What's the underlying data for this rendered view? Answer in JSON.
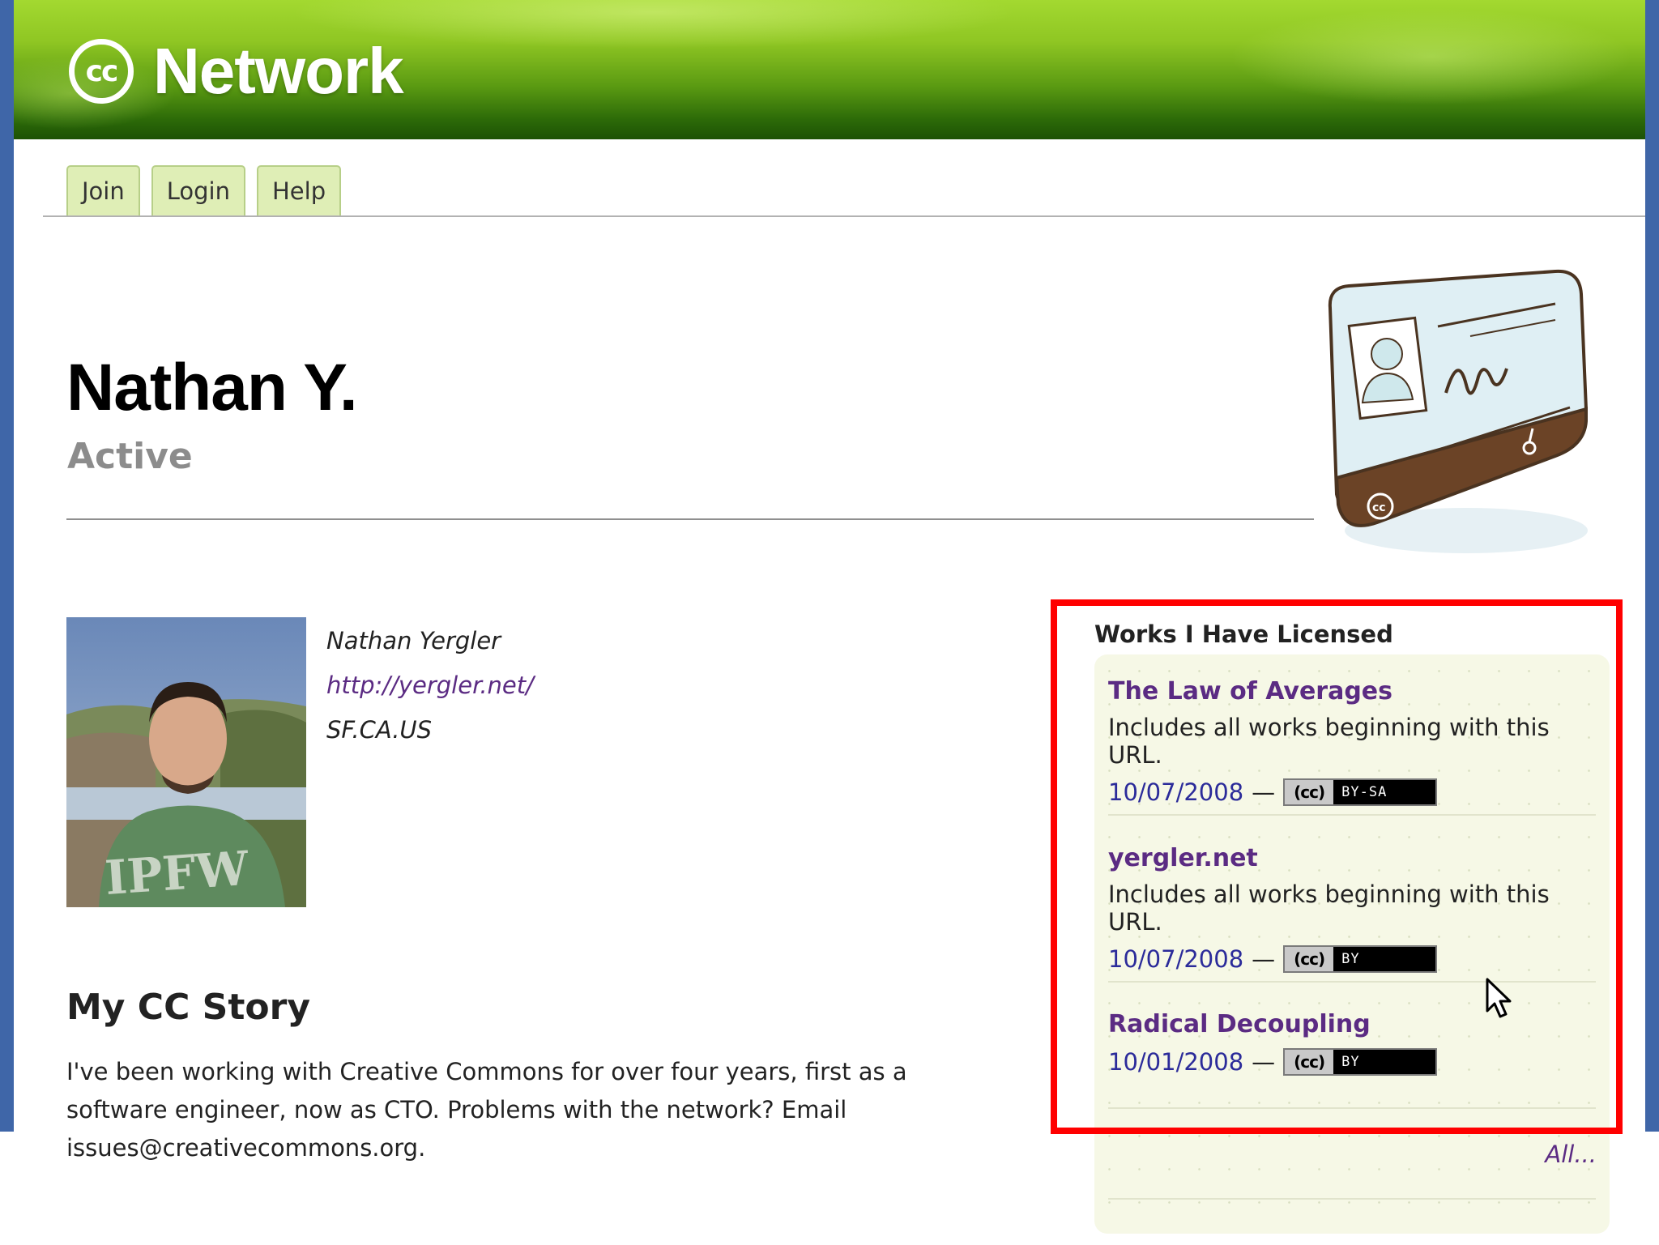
{
  "header": {
    "logo_icon": "cc-logo-icon",
    "logo_text": "Network"
  },
  "nav": {
    "tabs": [
      {
        "label": "Join"
      },
      {
        "label": "Login"
      },
      {
        "label": "Help"
      }
    ]
  },
  "profile": {
    "name": "Nathan Y.",
    "status": "Active",
    "full_name": "Nathan Yergler",
    "url": "http://yergler.net/",
    "location": "SF.CA.US"
  },
  "story": {
    "title": "My CC Story",
    "text": "I've been working with Creative Commons for over four years, first as a software engineer, now as CTO. Problems with the network? Email issues@creativecommons.org."
  },
  "works": {
    "heading": "Works I Have Licensed",
    "items": [
      {
        "title": "The Law of Averages",
        "description": "Includes all works beginning with this URL.",
        "date": "10/07/2008",
        "license": "BY-SA"
      },
      {
        "title": "yergler.net",
        "description": "Includes all works beginning with this URL.",
        "date": "10/07/2008",
        "license": "BY"
      },
      {
        "title": "Radical Decoupling",
        "description": "",
        "date": "10/01/2008",
        "license": "BY"
      }
    ],
    "all_link": "All...",
    "dash": "—",
    "badge_cc": "(cc)"
  },
  "colors": {
    "brand_green": "#5a9a12",
    "link_purple": "#5b2b83",
    "date_blue": "#2b2b9a",
    "highlight_red": "#ff0000",
    "side_blue": "#3f66a8"
  }
}
